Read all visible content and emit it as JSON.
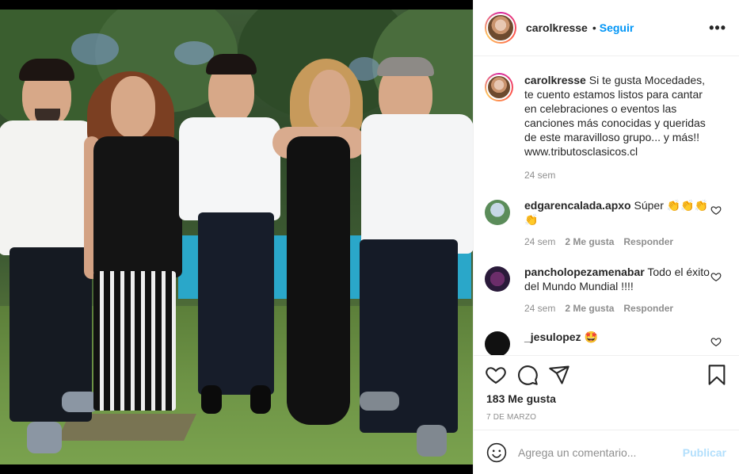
{
  "post": {
    "username": "carolkresse",
    "follow_label": "Seguir",
    "dot": "•",
    "more_label": "•••"
  },
  "comments": [
    {
      "username": "carolkresse",
      "text": "Si te gusta Mocedades, te cuento estamos listos para cantar en celebraciones o eventos las canciones más conocidas y queridas de este maravilloso grupo... y más!! www.tributosclasicos.cl",
      "time": "24 sem",
      "likes": "",
      "reply": ""
    },
    {
      "username": "edgarencalada.apxo",
      "text": "Súper 👏👏👏👏",
      "time": "24 sem",
      "likes": "2 Me gusta",
      "reply": "Responder"
    },
    {
      "username": "pancholopezamenabar",
      "text": "Todo el éxito del Mundo Mundial !!!!",
      "time": "24 sem",
      "likes": "2 Me gusta",
      "reply": "Responder"
    },
    {
      "username": "_jesulopez",
      "text": "🤩",
      "time": "",
      "likes": "",
      "reply": ""
    }
  ],
  "actions": {
    "likes": "183 Me gusta",
    "date": "7 DE MARZO"
  },
  "add_comment": {
    "placeholder": "Agrega un comentario...",
    "publish_label": "Publicar"
  },
  "icons": {
    "like": "heart-icon",
    "comment": "comment-icon",
    "share": "paper-plane-icon",
    "save": "bookmark-icon",
    "emoji": "smiley-icon",
    "more": "ellipsis-icon"
  },
  "colors": {
    "link_blue": "#0095f6",
    "publish_disabled": "#b2dffc",
    "muted": "#8e8e8e",
    "text": "#262626"
  }
}
